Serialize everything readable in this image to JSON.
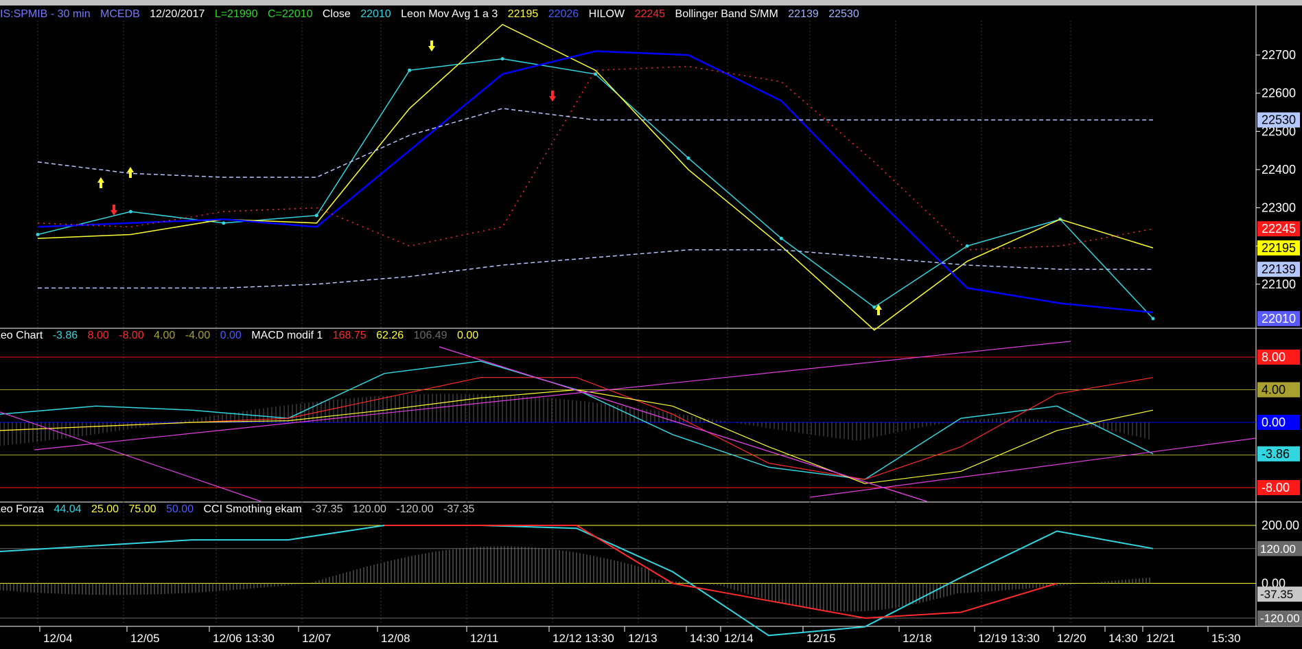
{
  "toolbar_strip": "",
  "header_main": {
    "symbol": "IS:SPMIB - 30 min",
    "source": "MCEDB",
    "date": "12/20/2017",
    "low": "L=21990",
    "close": "C=22010",
    "close_label": "Close",
    "close_value": "22010",
    "ma_label": "Leon Mov Avg 1 a 3",
    "ma_v1": "22195",
    "ma_v2": "22026",
    "hilow_label": "HILOW",
    "hilow_value": "22245",
    "bb_label": "Bollinger Band S/MM",
    "bb_v1": "22139",
    "bb_v2": "22530"
  },
  "header_leo": {
    "name": "Leo Chart",
    "v1": "-3.86",
    "v2": "8.00",
    "v3": "-8.00",
    "v4": "4.00",
    "v5": "-4.00",
    "v6": "0.00",
    "macd_label": "MACD modif 1",
    "m1": "168.75",
    "m2": "62.26",
    "m3": "106.49",
    "m4": "0.00"
  },
  "header_forza": {
    "name": "Leo Forza",
    "v1": "44.04",
    "v2": "25.00",
    "v3": "75.00",
    "v4": "50.00",
    "cci_label": "CCI Smothing ekam",
    "c1": "-37.35",
    "c2": "120.00",
    "c3": "-120.00",
    "c4": "-37.35"
  },
  "x_axis": [
    "12/04",
    "12/05",
    "12/06 13:30",
    "12/07",
    "12/08",
    "12/11",
    "12/12 13:30",
    "12/13",
    "14:30",
    "12/14",
    "12/15",
    "12/18",
    "12/19 13:30",
    "12/20",
    "14:30",
    "12/21",
    "15:30"
  ],
  "y_main_ticks": [
    "22700",
    "22600",
    "22500",
    "22400",
    "22300",
    "22200",
    "22100"
  ],
  "y_main_tags": [
    {
      "label": "22530",
      "bg": "#b4c8ff",
      "fg": "#000"
    },
    {
      "label": "22245",
      "bg": "#ff1a1a",
      "fg": "#fff"
    },
    {
      "label": "22195",
      "bg": "#ffff00",
      "fg": "#000"
    },
    {
      "label": "22139",
      "bg": "#b4c8ff",
      "fg": "#000"
    },
    {
      "label": "22010",
      "bg": "#5a5aff",
      "fg": "#fff"
    }
  ],
  "y_leo_tags": [
    {
      "label": "8.00",
      "bg": "#ff1a1a",
      "fg": "#fff"
    },
    {
      "label": "4.00",
      "bg": "#a8a030",
      "fg": "#000"
    },
    {
      "label": "0.00",
      "bg": "#0000ff",
      "fg": "#fff"
    },
    {
      "label": "-3.86",
      "bg": "#33d6e0",
      "fg": "#000"
    },
    {
      "label": "-8.00",
      "bg": "#ff1a1a",
      "fg": "#fff"
    }
  ],
  "y_forza_ticks": [
    "200.00",
    "0.00",
    "-120.0"
  ],
  "y_forza_tags": [
    {
      "label": "120.00",
      "bg": "#6a6a6a",
      "fg": "#fff"
    },
    {
      "label": "-37.35",
      "bg": "#c8c8c8",
      "fg": "#000"
    },
    {
      "label": "-120.00",
      "bg": "#6a6a6a",
      "fg": "#fff"
    }
  ],
  "chart_data": {
    "type": "line",
    "x": [
      "12/04",
      "12/05",
      "12/06",
      "12/07",
      "12/08",
      "12/11",
      "12/12",
      "12/13",
      "12/14",
      "12/15",
      "12/18",
      "12/19",
      "12/20"
    ],
    "series": [
      {
        "name": "Close",
        "color": "#33d6e0",
        "values": [
          22230,
          22290,
          22260,
          22280,
          22660,
          22690,
          22650,
          22430,
          22220,
          22040,
          22200,
          22270,
          22010
        ]
      },
      {
        "name": "Leon Mov Avg 1 a 3",
        "color": "#ffff33",
        "values": [
          22220,
          22230,
          22270,
          22260,
          22560,
          22780,
          22660,
          22400,
          22200,
          21980,
          22160,
          22270,
          22195
        ]
      },
      {
        "name": "",
        "color": "#0000ff",
        "values": [
          22250,
          22260,
          22270,
          22250,
          22450,
          22650,
          22710,
          22700,
          22580,
          22330,
          22090,
          22050,
          22026
        ]
      },
      {
        "name": "HILOW",
        "color": "#ff2b2b",
        "values": [
          22260,
          22250,
          22290,
          22300,
          22200,
          22250,
          22660,
          22670,
          22630,
          22420,
          22190,
          22200,
          22245
        ]
      },
      {
        "name": "Bollinger Band S/MM",
        "color": "#b4c8ff",
        "values": [
          22420,
          22390,
          22380,
          22380,
          22490,
          22560,
          22530,
          22530,
          22530,
          22530,
          22530,
          22530,
          22530
        ]
      },
      {
        "name": "",
        "color": "#b4c8ff",
        "values": [
          22090,
          22090,
          22090,
          22100,
          22120,
          22150,
          22170,
          22190,
          22190,
          22170,
          22150,
          22139,
          22139
        ]
      }
    ],
    "ylim": [
      21990,
      22790
    ]
  }
}
